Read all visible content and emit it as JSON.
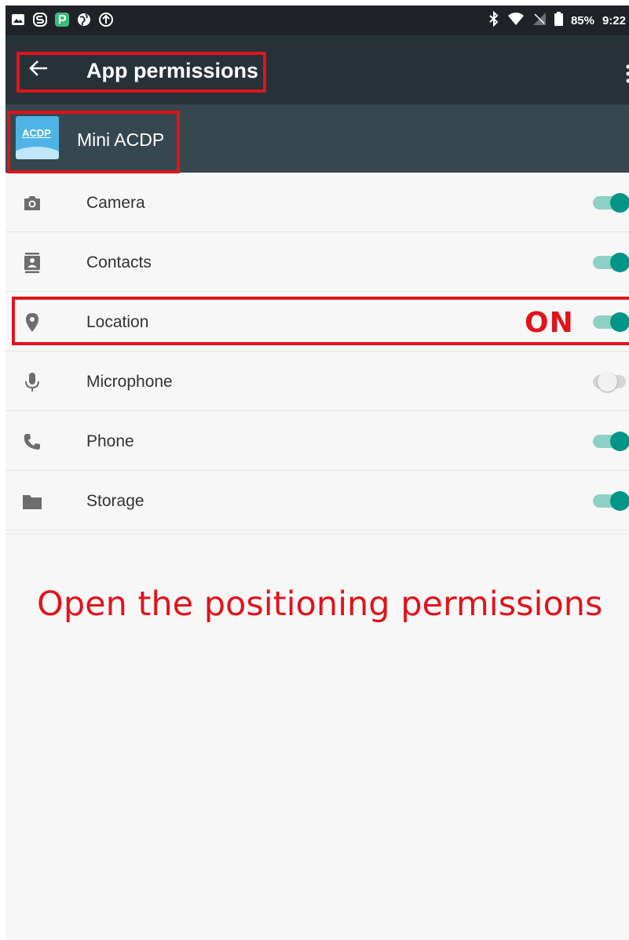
{
  "status_bar": {
    "battery": "85%",
    "time": "9:22",
    "left_icons": [
      "image-icon",
      "s-icon",
      "p-app-icon",
      "globe-icon",
      "upload-icon"
    ],
    "right_icons": [
      "bluetooth-icon",
      "wifi-icon",
      "no-signal-icon",
      "battery-icon"
    ]
  },
  "toolbar": {
    "title": "App permissions",
    "back_icon": "arrow-left-icon",
    "menu_icon": "more-vert-icon"
  },
  "app": {
    "name": "Mini ACDP",
    "icon_text": "ACDP"
  },
  "permissions": [
    {
      "label": "Camera",
      "icon": "camera-icon",
      "enabled": true
    },
    {
      "label": "Contacts",
      "icon": "contacts-icon",
      "enabled": true
    },
    {
      "label": "Location",
      "icon": "location-pin-icon",
      "enabled": true
    },
    {
      "label": "Microphone",
      "icon": "microphone-icon",
      "enabled": false
    },
    {
      "label": "Phone",
      "icon": "phone-icon",
      "enabled": true
    },
    {
      "label": "Storage",
      "icon": "folder-icon",
      "enabled": true
    }
  ],
  "annotations": {
    "on_label": "ON",
    "caption": "Open the positioning permissions"
  },
  "colors": {
    "toolbar": "#263238",
    "app_header": "#37474f",
    "toggle_on": "#009587",
    "annotation_red": "#e0141b"
  }
}
